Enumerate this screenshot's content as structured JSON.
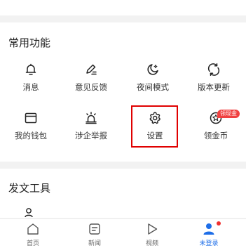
{
  "colors": {
    "background": "#f2f2f2",
    "card": "#ffffff",
    "icon_stroke": "#222222",
    "highlight": "#e00000",
    "badge": "#f04040",
    "tab_active": "#1e6ee8",
    "tab_inactive": "#666666"
  },
  "functions": {
    "title": "常用功能",
    "items": [
      {
        "label": "消息",
        "icon": "bell-icon"
      },
      {
        "label": "意见反馈",
        "icon": "pen-icon"
      },
      {
        "label": "夜间模式",
        "icon": "moon-icon"
      },
      {
        "label": "版本更新",
        "icon": "refresh-icon"
      },
      {
        "label": "我的钱包",
        "icon": "wallet-icon"
      },
      {
        "label": "涉企举报",
        "icon": "alarm-icon"
      },
      {
        "label": "设置",
        "icon": "gear-icon"
      },
      {
        "label": "领金币",
        "icon": "coin-icon"
      }
    ],
    "badge": "领现金"
  },
  "publish": {
    "title": "发文工具"
  },
  "tabbar": {
    "tabs": [
      {
        "label": "首页",
        "icon": "home-icon"
      },
      {
        "label": "新闻",
        "icon": "news-icon"
      },
      {
        "label": "视频",
        "icon": "play-icon"
      },
      {
        "label": "未登录",
        "icon": "user-icon"
      }
    ]
  }
}
